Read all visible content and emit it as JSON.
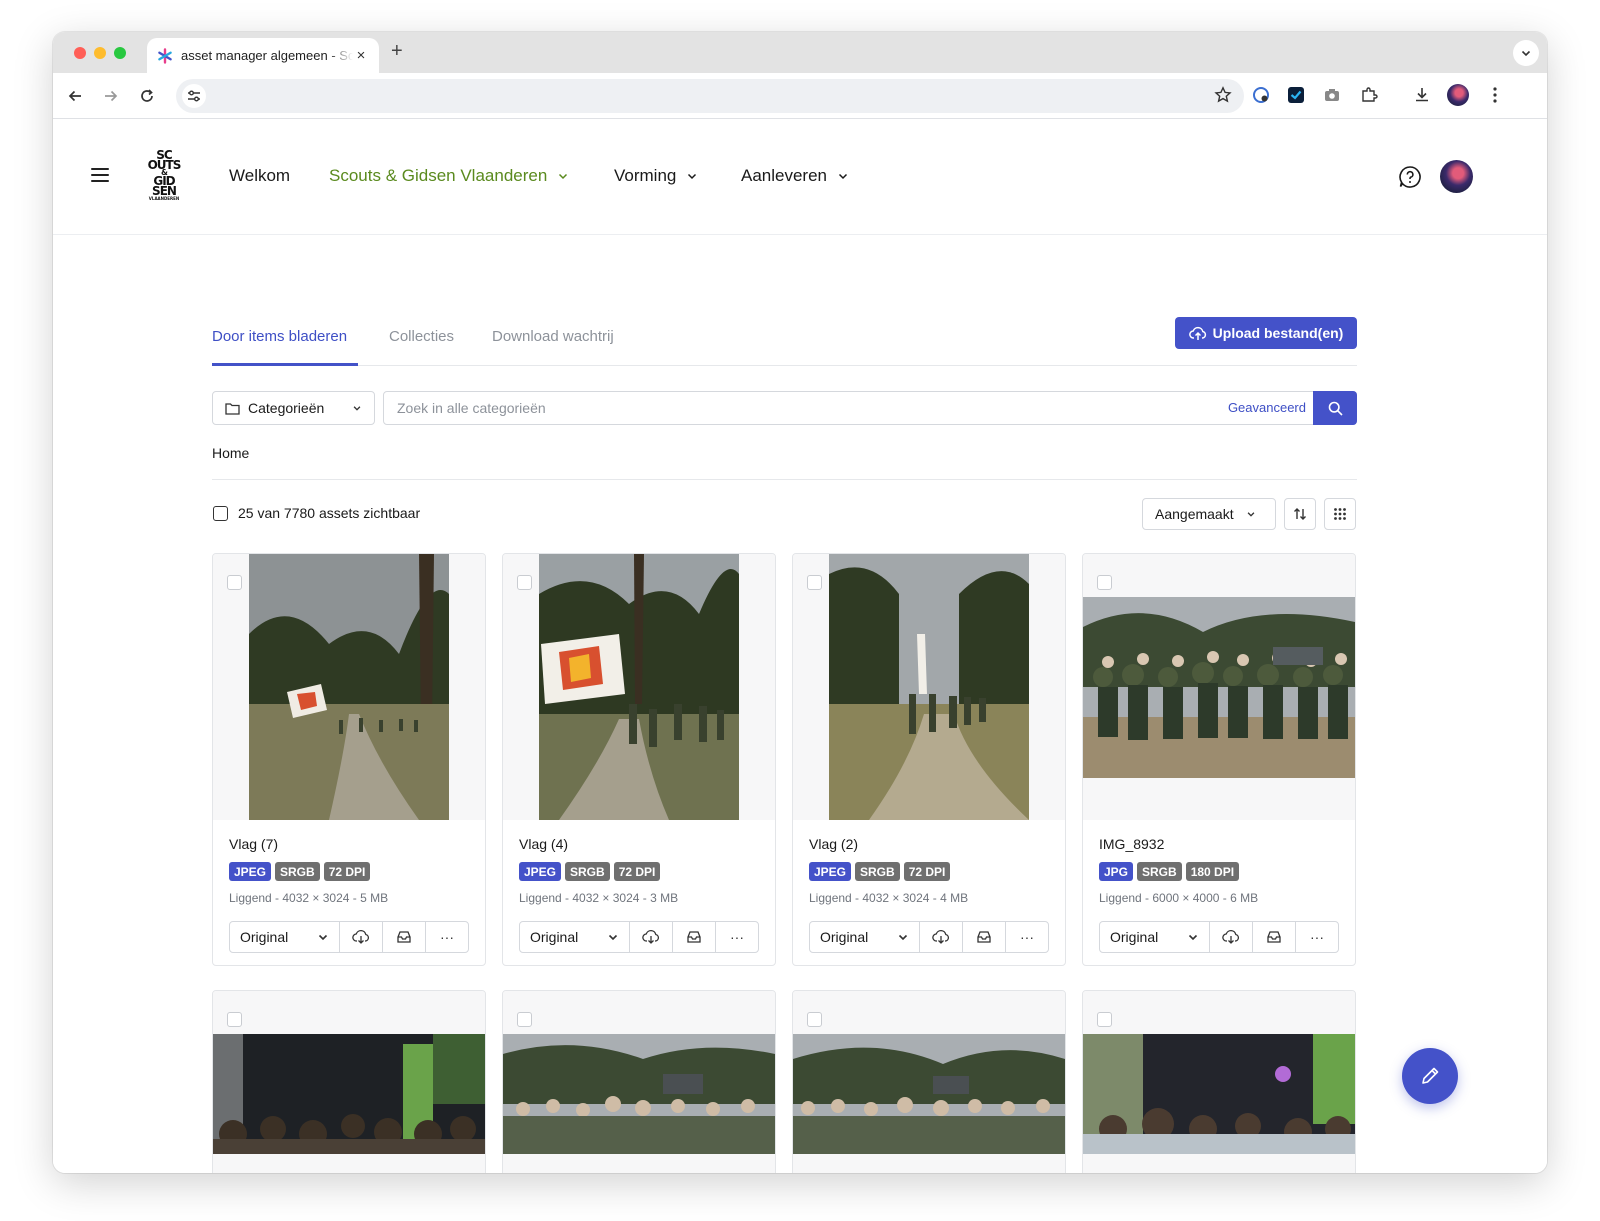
{
  "browser": {
    "tab_title": "asset manager algemeen - Sc",
    "close_glyph": "×",
    "new_tab_glyph": "+",
    "traffic_lights": [
      "#ff5f57",
      "#febc2e",
      "#28c840"
    ]
  },
  "nav": {
    "links": [
      "Welkom",
      "Scouts & Gidsen Vlaanderen",
      "Vorming",
      "Aanleveren"
    ],
    "accent_color": "#5a8a1e",
    "logo_text": [
      "SC",
      "OUTS",
      "&",
      "GID",
      "SEN",
      "VLAANDEREN"
    ]
  },
  "page_tabs": {
    "items": [
      "Door items bladeren",
      "Collecties",
      "Download wachtrij"
    ],
    "active": "Door items bladeren",
    "upload_label": "Upload bestand(en)"
  },
  "search": {
    "category_label": "Categorieën",
    "placeholder": "Zoek in alle categorieën",
    "advanced_label": "Geavanceerd"
  },
  "breadcrumb": "Home",
  "results": {
    "count_label": "25 van 7780 assets zichtbaar",
    "sort_label": "Aangemaakt"
  },
  "assets": [
    {
      "name": "Vlag (7)",
      "format": "JPEG",
      "colorspace": "SRGB",
      "dpi": "72 DPI",
      "meta": "Liggend - 4032 × 3024 - 5 MB",
      "variant": "Original",
      "more": "···"
    },
    {
      "name": "Vlag (4)",
      "format": "JPEG",
      "colorspace": "SRGB",
      "dpi": "72 DPI",
      "meta": "Liggend - 4032 × 3024 - 3 MB",
      "variant": "Original",
      "more": "···"
    },
    {
      "name": "Vlag (2)",
      "format": "JPEG",
      "colorspace": "SRGB",
      "dpi": "72 DPI",
      "meta": "Liggend - 4032 × 3024 - 4 MB",
      "variant": "Original",
      "more": "···"
    },
    {
      "name": "IMG_8932",
      "format": "JPG",
      "colorspace": "SRGB",
      "dpi": "180 DPI",
      "meta": "Liggend - 6000 × 4000 - 6 MB",
      "variant": "Original",
      "more": "···"
    }
  ],
  "colors": {
    "primary": "#4452c9",
    "badge_gray": "#6f6f6f"
  }
}
